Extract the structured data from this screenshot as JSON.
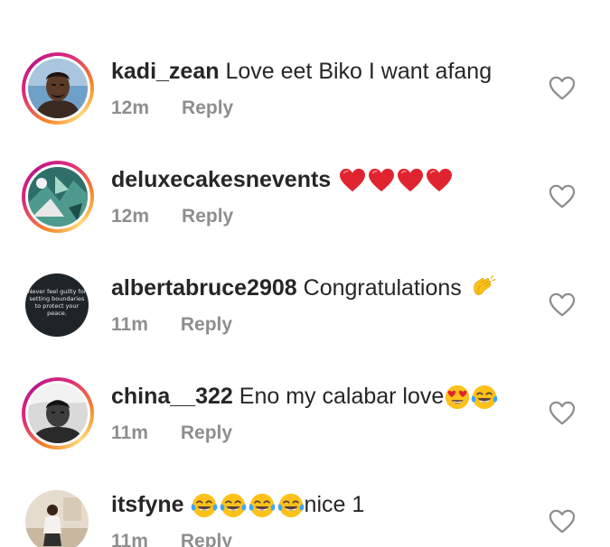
{
  "comments": [
    {
      "username": "kadi_zean",
      "text": "Love eet Biko I want afang",
      "time": "12m",
      "reply_label": "Reply",
      "avatar_icon": "profile-photo-man",
      "emojis": []
    },
    {
      "username": "deluxecakesnevents",
      "text": "",
      "time": "12m",
      "reply_label": "Reply",
      "avatar_icon": "profile-photo-teal-abstract",
      "emojis": [
        "red-heart",
        "red-heart",
        "red-heart",
        "red-heart"
      ]
    },
    {
      "username": "albertabruce2908",
      "text": "Congratulations",
      "time": "11m",
      "reply_label": "Reply",
      "avatar_icon": "profile-photo-quote",
      "avatar_quote": "Never feel guilty for setting boundaries to protect your peace.",
      "emojis": [
        "clapping-hands"
      ]
    },
    {
      "username": "china__322",
      "text": "Eno my calabar love",
      "time": "11m",
      "reply_label": "Reply",
      "avatar_icon": "profile-photo-bw-boy",
      "emojis": [
        "heart-eyes-face",
        "tears-of-joy-face"
      ]
    },
    {
      "username": "itsfyne",
      "text": "nice 1",
      "time": "11m",
      "reply_label": "Reply",
      "avatar_icon": "profile-photo-woman-room",
      "emojis": [
        "tears-of-joy-face",
        "tears-of-joy-face",
        "tears-of-joy-face",
        "tears-of-joy-face"
      ]
    }
  ],
  "colors": {
    "text": "#262626",
    "meta": "#8e8e8e",
    "heart_outline": "#8e8e8e",
    "story_ring_start": "#f58529",
    "story_ring_end": "#dd2a7b",
    "emoji_heart": "#e0242f",
    "emoji_yellow": "#fcc21b"
  }
}
